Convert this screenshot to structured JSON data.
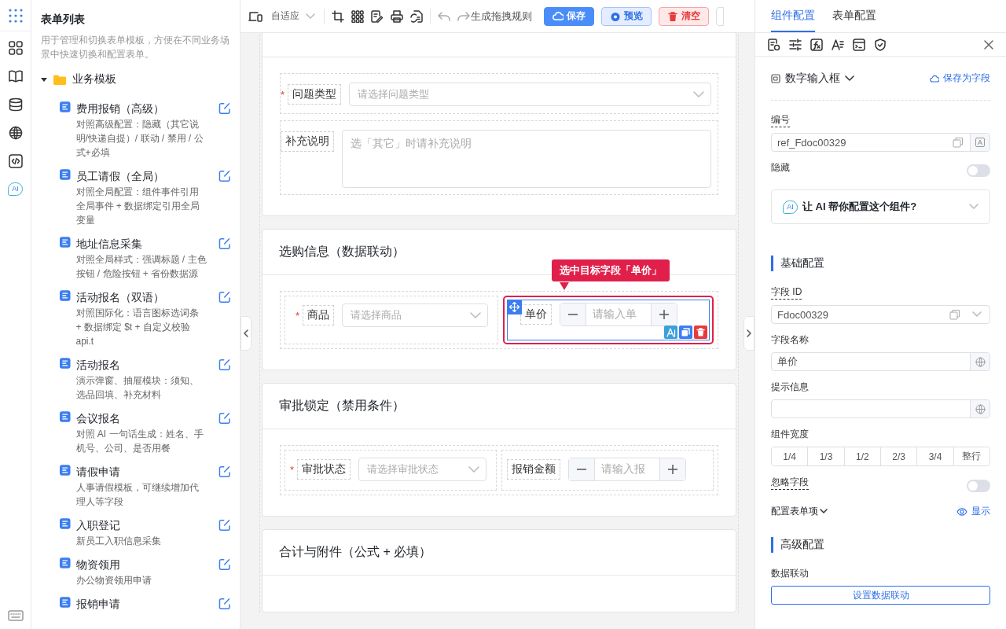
{
  "rail": {
    "ai_badge": "AI"
  },
  "sidebar": {
    "title": "表单列表",
    "description": "用于管理和切换表单模板，方便在不同业务场景中快速切换和配置表单。",
    "tree": [
      {
        "label": "业务模板",
        "expanded": true,
        "children": [
          {
            "title": "费用报销（高级）",
            "description": "对照高级配置：隐藏（其它说明/快递自提）/ 联动 / 禁用 / 公式+必填"
          },
          {
            "title": "员工请假（全局）",
            "description": "对照全局配置：组件事件引用全局事件 + 数据绑定引用全局变量"
          },
          {
            "title": "地址信息采集",
            "description": "对照全局样式：强调标题 / 主色按钮 / 危险按钮 + 省份数据源"
          },
          {
            "title": "活动报名（双语）",
            "description": "对照国际化：语言图标选词条 + 数据绑定 $t + 自定义校验 api.t"
          },
          {
            "title": "活动报名",
            "description": "演示弹窗、抽屉模块：须知、选品回填、补充材料"
          },
          {
            "title": "会议报名",
            "description": "对照 AI 一句话生成：姓名、手机号、公司、是否用餐"
          },
          {
            "title": "请假申请",
            "description": "人事请假模板，可继续增加代理人等字段"
          },
          {
            "title": "入职登记",
            "description": "新员工入职信息采集"
          },
          {
            "title": "物资领用",
            "description": "办公物资领用申请"
          },
          {
            "title": "报销申请"
          }
        ]
      }
    ]
  },
  "toolbar": {
    "device_select": "自适应",
    "rule_text": "生成拖拽规则",
    "buttons": [
      {
        "label": "保存",
        "kind": "primary"
      },
      {
        "label": "预览",
        "kind": "secondary"
      },
      {
        "label": "清空",
        "kind": "danger"
      }
    ]
  },
  "canvas": {
    "sections": [
      {
        "rows": [
          {
            "fields": [
              {
                "label": "问题类型",
                "required_mark": "*",
                "kind": "select",
                "placeholder": "请选择问题类型",
                "selected": false
              }
            ]
          },
          {
            "fields": [
              {
                "label": "补充说明",
                "kind": "textarea",
                "placeholder": "选「其它」时请补充说明",
                "selected": false
              }
            ]
          }
        ]
      },
      {
        "title": "选购信息（数据联动）",
        "rows": [
          {
            "fields": [
              {
                "label": "商品",
                "required_mark": "*",
                "kind": "select",
                "placeholder": "请选择商品",
                "selected": false
              },
              {
                "label": "单价",
                "kind": "number",
                "placeholder": "请输入单",
                "selected": true,
                "tooltip": "选中目标字段「单价」"
              }
            ]
          }
        ]
      },
      {
        "title": "审批锁定（禁用条件）",
        "rows": [
          {
            "fields": [
              {
                "label": "审批状态",
                "required_mark": "*",
                "kind": "select",
                "placeholder": "请选择审批状态",
                "selected": false
              },
              {
                "label": "报销金额",
                "kind": "number",
                "placeholder": "请输入报",
                "selected": false
              }
            ]
          }
        ]
      },
      {
        "title": "合计与附件（公式 + 必填）"
      }
    ]
  },
  "panel": {
    "tabs": [
      {
        "label": "组件配置",
        "selected": true
      },
      {
        "label": "表单配置",
        "selected": false
      }
    ],
    "component_type": "数字输入框",
    "save_link": "保存为字段",
    "items": [
      {
        "kind": "input",
        "label": "编号",
        "hint": true,
        "value": "ref_Fdoc00329",
        "copyable": true,
        "letter_addon": true
      },
      {
        "kind": "toggle",
        "label": "隐藏",
        "hint": false,
        "on": false
      },
      {
        "kind": "ai",
        "badge": "AI",
        "label": "让 AI 帮你配置这个组件?"
      },
      {
        "kind": "section",
        "label": "基础配置"
      },
      {
        "kind": "input",
        "label": "字段 ID",
        "hint": true,
        "value": "Fdoc00329",
        "copyable": true,
        "dropdown": true
      },
      {
        "kind": "input",
        "label": "字段名称",
        "hint": false,
        "value": "单价",
        "translatable": true
      },
      {
        "kind": "input",
        "label": "提示信息",
        "hint": false,
        "translatable": true
      },
      {
        "kind": "segmented",
        "label": "组件宽度",
        "options": [
          {
            "label": "1/4",
            "selected": false
          },
          {
            "label": "1/3",
            "selected": false
          },
          {
            "label": "1/2",
            "selected": false
          },
          {
            "label": "2/3",
            "selected": false
          },
          {
            "label": "3/4",
            "selected": false
          },
          {
            "label": "整行",
            "selected": false
          }
        ]
      },
      {
        "kind": "toggle",
        "label": "忽略字段",
        "hint": true,
        "on": false
      },
      {
        "kind": "linkrow",
        "label": "配置表单项",
        "link": "显示"
      },
      {
        "kind": "section",
        "label": "高级配置"
      },
      {
        "kind": "button",
        "label": "数据联动",
        "button": "设置数据联动"
      }
    ]
  }
}
